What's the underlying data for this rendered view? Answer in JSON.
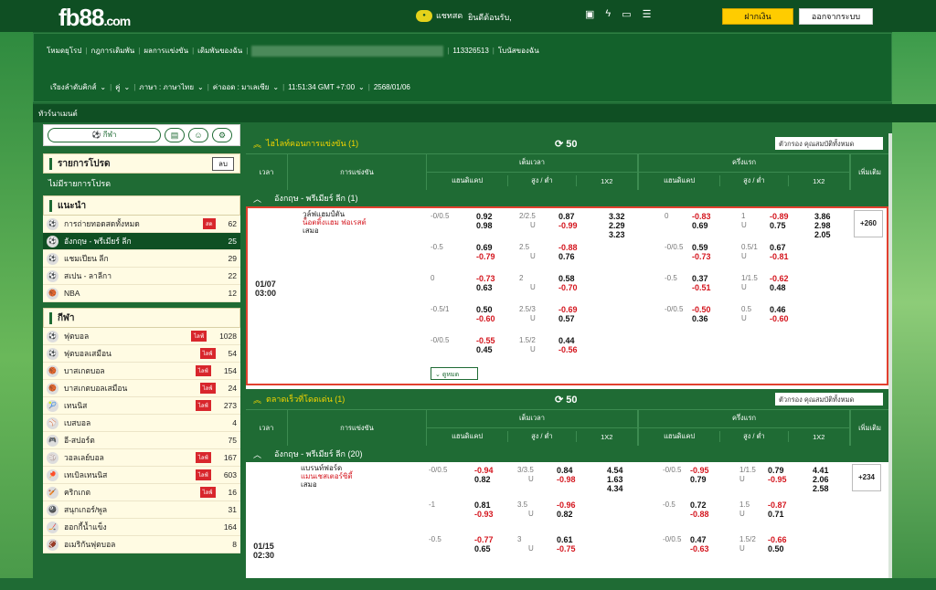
{
  "header": {
    "logo": "fb88",
    "logo_suffix": ".com",
    "chat": "แชทสด",
    "welcome": "ยินดีต้อนรับ,",
    "deposit": "ฝากเงิน",
    "logout": "ออกจากระบบ",
    "icons": [
      "bag-icon",
      "flash-icon",
      "toto-icon",
      "checklist-icon"
    ]
  },
  "nav": {
    "r1": [
      "โหมดยุโรป",
      "กฎการเดิมพัน",
      "ผลการแข่งขัน",
      "เดิมพันของฉัน"
    ],
    "account": "113326513",
    "promo": "โบนัสของฉัน",
    "r2": [
      "เรียงลำดับคิกส์",
      "คู่",
      "ภาษา : ภาษาไทย",
      "ค่าออด : มาเลเซีย",
      "11:51:34 GMT +7:00",
      "2568/01/06"
    ]
  },
  "crumb": "ทัวร์นาเมนต์",
  "side": {
    "sport_btn": "กีฬา",
    "fav_title": "รายการโปรด",
    "fav_btn": "ลบ",
    "no_fav": "ไม่มีรายการโปรด",
    "rec_title": "แนะนำ",
    "rec": [
      {
        "icon": "⚽",
        "name": "การถ่ายทอดสดทั้งหมด",
        "cnt": "62",
        "live": "สด"
      },
      {
        "icon": "⚽",
        "name": "อังกฤษ - พรีเมียร์ ลีก",
        "cnt": "25",
        "sel": true
      },
      {
        "icon": "⚽",
        "name": "แชมเปียน ลีก",
        "cnt": "29"
      },
      {
        "icon": "⚽",
        "name": "สเปน - ลาลีกา",
        "cnt": "22"
      },
      {
        "icon": "🏀",
        "name": "NBA",
        "cnt": "12"
      }
    ],
    "sport_title": "กีฬา",
    "sports": [
      {
        "icon": "⚽",
        "name": "ฟุตบอล",
        "cnt": "1028",
        "live": "ไลฟ์"
      },
      {
        "icon": "⚽",
        "name": "ฟุตบอลเสมือน",
        "cnt": "54",
        "live": "ไลฟ์"
      },
      {
        "icon": "🏀",
        "name": "บาสเกตบอล",
        "cnt": "154",
        "live": "ไลฟ์"
      },
      {
        "icon": "🏀",
        "name": "บาสเกตบอลเสมือน",
        "cnt": "24",
        "live": "ไลฟ์"
      },
      {
        "icon": "🎾",
        "name": "เทนนิส",
        "cnt": "273",
        "live": "ไลฟ์"
      },
      {
        "icon": "⚾",
        "name": "เบสบอล",
        "cnt": "4"
      },
      {
        "icon": "🎮",
        "name": "อี-สปอร์ต",
        "cnt": "75"
      },
      {
        "icon": "🏐",
        "name": "วอลเลย์บอล",
        "cnt": "167",
        "live": "ไลฟ์"
      },
      {
        "icon": "🏓",
        "name": "เทเบิลเทนนิส",
        "cnt": "603",
        "live": "ไลฟ์"
      },
      {
        "icon": "🏏",
        "name": "คริกเกต",
        "cnt": "16",
        "live": "ไลฟ์"
      },
      {
        "icon": "🎱",
        "name": "สนุกเกอร์/พูล",
        "cnt": "31"
      },
      {
        "icon": "🏒",
        "name": "ฮอกกี้น้ำแข็ง",
        "cnt": "164"
      },
      {
        "icon": "🏈",
        "name": "อเมริกันฟุตบอล",
        "cnt": "8"
      }
    ]
  },
  "main": {
    "hl": {
      "title": "ไฮไลท์คอนการแข่งขัน (1)",
      "cnt": "50",
      "filter": "ตัวกรอง คุณสมบัติทั้งหมด"
    },
    "cols": {
      "time": "เวลา",
      "match": "การแข่งขัน",
      "ft": "เต็มเวลา",
      "ht": "ครึ่งแรก",
      "hdp": "แฮนดิแคป",
      "ou": "สูง / ต่ำ",
      "x12": "1X2",
      "more": "เพิ่มเติม"
    },
    "league": "อังกฤษ - พรีเมียร์ ลีก (1)",
    "m1": {
      "date": "01/07",
      "time": "03:00",
      "home": "วูล์ฟแฮมป์ตัน",
      "away": "น็อตติ้งแฮม ฟอเรสต์",
      "draw": "เสมอ",
      "more": "+260",
      "toggle": "ดูหมด"
    },
    "rows1": [
      [
        "-0/0.5",
        "0.92",
        "0.98",
        "2/2.5",
        "U",
        "0.87",
        "-0.99",
        "3.32",
        "2.29",
        "3.23",
        "0",
        "-0.83",
        "0.69",
        "1",
        "U",
        "-0.89",
        "0.75",
        "3.86",
        "2.98",
        "2.05"
      ],
      [
        "-0.5",
        "0.69",
        "-0.79",
        "2.5",
        "U",
        "-0.88",
        "0.76",
        "",
        "",
        "",
        "-0/0.5",
        "0.59",
        "-0.73",
        "0.5/1",
        "U",
        "0.67",
        "-0.81",
        "",
        "",
        ""
      ],
      [
        "0",
        "-0.73",
        "0.63",
        "2",
        "U",
        "0.58",
        "-0.70",
        "",
        "",
        "",
        "-0.5",
        "0.37",
        "-0.51",
        "1/1.5",
        "U",
        "-0.62",
        "0.48",
        "",
        "",
        ""
      ],
      [
        "-0.5/1",
        "0.50",
        "-0.60",
        "2.5/3",
        "U",
        "-0.69",
        "0.57",
        "",
        "",
        "",
        "-0/0.5",
        "-0.50",
        "0.36",
        "0.5",
        "U",
        "0.46",
        "-0.60",
        "",
        "",
        ""
      ],
      [
        "-0/0.5",
        "-0.55",
        "0.45",
        "1.5/2",
        "U",
        "0.44",
        "-0.56",
        "",
        "",
        "",
        "",
        "",
        "",
        "",
        "",
        "",
        "",
        "",
        "",
        ""
      ]
    ],
    "ev": {
      "title": "ตลาดเร็วที่โดดเด่น (1)",
      "cnt": "50",
      "filter": "ตัวกรอง คุณสมบัติทั้งหมด"
    },
    "league2": "อังกฤษ - พรีเมียร์ ลีก (20)",
    "m2": {
      "date": "01/15",
      "time": "02:30",
      "home": "แบรนท์ฟอร์ด",
      "away": "แมนเชสเตอร์ซิตี้",
      "draw": "เสมอ",
      "more": "+234"
    },
    "rows2": [
      [
        "-0/0.5",
        "-0.94",
        "0.82",
        "3/3.5",
        "U",
        "0.84",
        "-0.98",
        "4.54",
        "1.63",
        "4.34",
        "-0/0.5",
        "-0.95",
        "0.79",
        "1/1.5",
        "U",
        "0.79",
        "-0.95",
        "4.41",
        "2.06",
        "2.58"
      ],
      [
        "-1",
        "0.81",
        "-0.93",
        "3.5",
        "U",
        "-0.96",
        "0.82",
        "",
        "",
        "",
        "-0.5",
        "0.72",
        "-0.88",
        "1.5",
        "U",
        "-0.87",
        "0.71",
        "",
        "",
        ""
      ],
      [
        "-0.5",
        "-0.77",
        "0.65",
        "3",
        "U",
        "0.61",
        "-0.75",
        "",
        "",
        "",
        "-0/0.5",
        "0.47",
        "-0.63",
        "1.5/2",
        "U",
        "-0.66",
        "0.50",
        "",
        "",
        ""
      ]
    ]
  }
}
